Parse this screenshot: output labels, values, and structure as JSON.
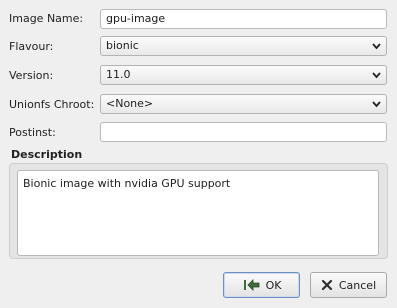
{
  "form": {
    "image_name_label": "Image Name:",
    "image_name_value": "gpu-image",
    "flavour_label": "Flavour:",
    "flavour_value": "bionic",
    "version_label": "Version:",
    "version_value": "11.0",
    "unionfs_label": "Unionfs Chroot:",
    "unionfs_value": "<None>",
    "postinst_label": "Postinst:",
    "postinst_value": ""
  },
  "description": {
    "title": "Description",
    "text": "Bionic image with nvidia GPU support"
  },
  "buttons": {
    "ok_label": "OK",
    "cancel_label": "Cancel"
  },
  "icons": {
    "ok": "ok-arrow-icon",
    "cancel": "cancel-x-icon",
    "dropdown": "chevron-down-icon"
  }
}
